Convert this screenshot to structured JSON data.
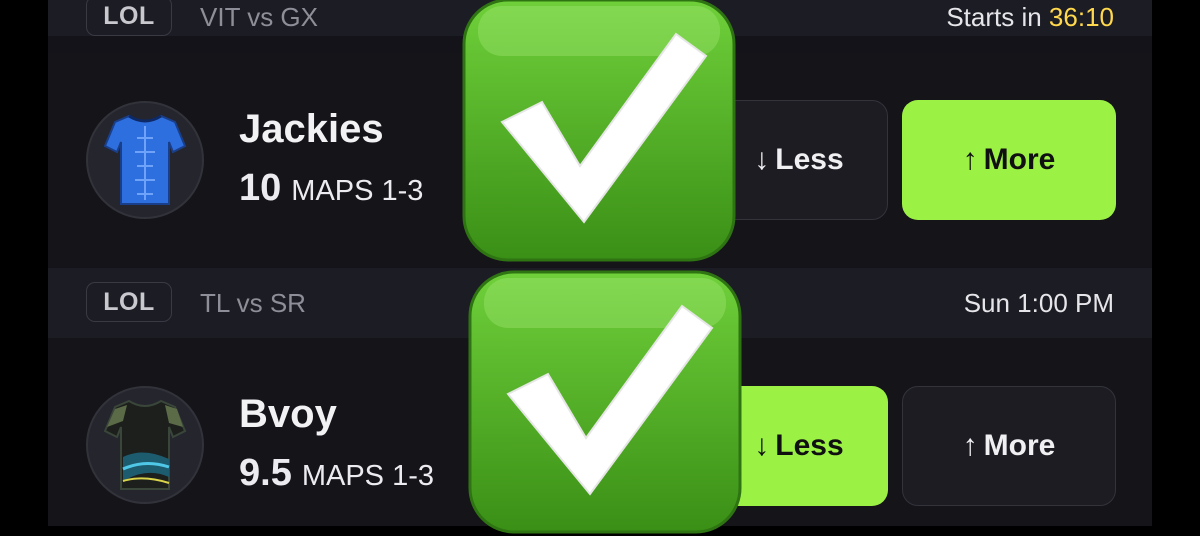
{
  "colors": {
    "accent_green": "#9cf145",
    "timer_yellow": "#ffd84d",
    "check_green": "#4aa51d"
  },
  "cards": [
    {
      "league": "LOL",
      "matchup": "VIT vs GX",
      "time_prefix": "Starts in",
      "time_value": "36:10",
      "player": "Jackies",
      "line": "10",
      "stat": "MAPS 1-3",
      "less_label": "Less",
      "more_label": "More",
      "selected": "More",
      "jersey_icon": "blue-jersey-icon"
    },
    {
      "league": "LOL",
      "matchup": "TL vs SR",
      "time_prefix": "",
      "time_value": "Sun 1:00 PM",
      "player": "Bvoy",
      "line": "9.5",
      "stat": "MAPS 1-3",
      "less_label": "Less",
      "more_label": "More",
      "selected": "Less",
      "jersey_icon": "camo-jersey-icon"
    }
  ],
  "arrows": {
    "down": "↓",
    "up": "↑"
  },
  "overlay": {
    "icon": "check-mark-emoji",
    "count": 2
  }
}
